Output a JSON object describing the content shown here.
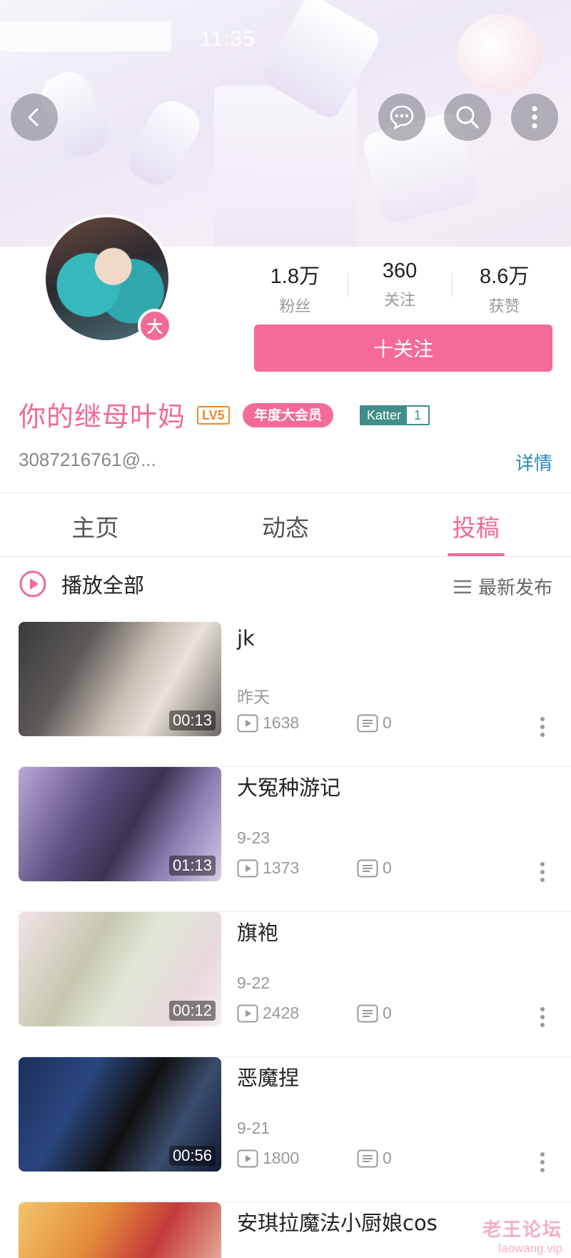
{
  "status_bar": {
    "time": "11:35"
  },
  "header": {
    "back_icon": "chevron-left-icon",
    "message_icon": "chat-bubble-icon",
    "search_icon": "search-icon",
    "more_icon": "more-vertical-icon"
  },
  "profile": {
    "avatar_badge": "大",
    "name": "你的继母叶妈",
    "level_badge": "LV5",
    "vip_badge": "年度大会员",
    "medal_name": "Katter",
    "medal_level": "1",
    "uid": "3087216761@...",
    "detail_label": "详情",
    "follow_label": "十关注",
    "stats": [
      {
        "value": "1.8万",
        "label": "粉丝"
      },
      {
        "value": "360",
        "label": "关注"
      },
      {
        "value": "8.6万",
        "label": "获赞"
      }
    ]
  },
  "tabs": [
    {
      "label": "主页",
      "active": false
    },
    {
      "label": "动态",
      "active": false
    },
    {
      "label": "投稿",
      "active": true
    }
  ],
  "list_header": {
    "play_all_label": "播放全部",
    "sort_label": "最新发布"
  },
  "videos": [
    {
      "title": "jk",
      "date": "昨天",
      "duration": "00:13",
      "plays": "1638",
      "comments": "0"
    },
    {
      "title": "大冤种游记",
      "date": "9-23",
      "duration": "01:13",
      "plays": "1373",
      "comments": "0"
    },
    {
      "title": "旗袍",
      "date": "9-22",
      "duration": "00:12",
      "plays": "2428",
      "comments": "0"
    },
    {
      "title": "恶魔捏",
      "date": "9-21",
      "duration": "00:56",
      "plays": "1800",
      "comments": "0"
    },
    {
      "title": "安琪拉魔法小厨娘cos",
      "date": "",
      "duration": "",
      "plays": "",
      "comments": ""
    }
  ],
  "watermark": {
    "line1": "老王论坛",
    "line2": "laowang.vip"
  },
  "colors": {
    "accent": "#f56a98",
    "link": "#2a8bb8",
    "level": "#f08a2c",
    "medal": "#3f8f88"
  }
}
